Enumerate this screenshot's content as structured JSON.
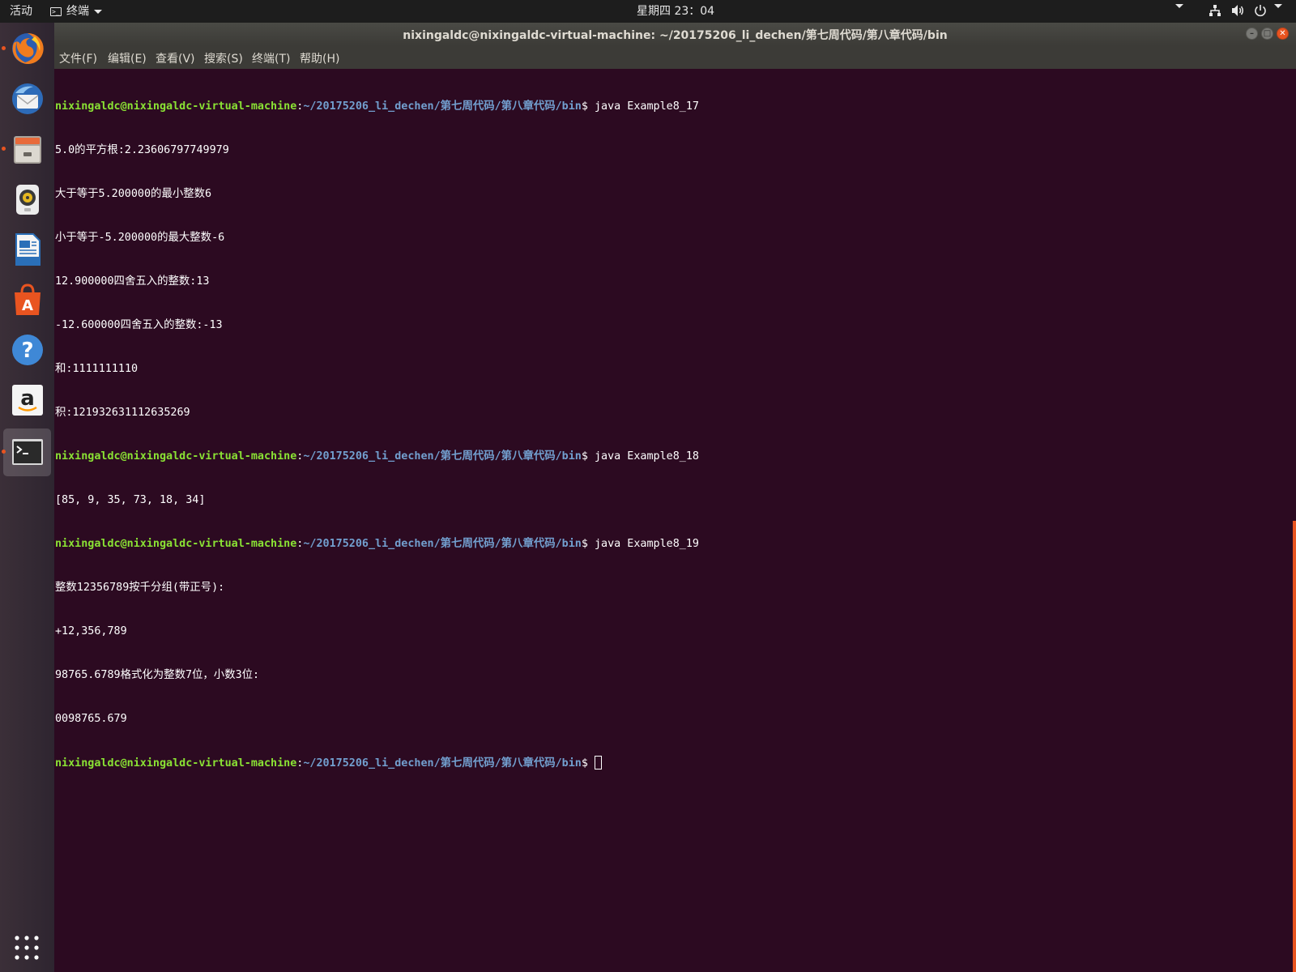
{
  "topbar": {
    "activities": "活动",
    "app_menu": "终端",
    "clock": "星期四 23：04",
    "icons": [
      "network-icon",
      "volume-icon",
      "power-icon"
    ]
  },
  "window": {
    "title": "nixingaldc@nixingaldc-virtual-machine: ~/20175206_li_dechen/第七周代码/第八章代码/bin"
  },
  "menubar": {
    "items": [
      "文件(F)",
      "编辑(E)",
      "查看(V)",
      "搜索(S)",
      "终端(T)",
      "帮助(H)"
    ]
  },
  "dock": {
    "items": [
      "firefox-icon",
      "thunderbird-icon",
      "files-icon",
      "rhythmbox-icon",
      "libreoffice-writer-icon",
      "software-center-icon",
      "help-icon",
      "amazon-icon",
      "terminal-icon"
    ],
    "show_apps": "show-applications-icon"
  },
  "terminal": {
    "prompt_user": "nixingaldc@nixingaldc-virtual-machine",
    "prompt_path": "~/20175206_li_dechen/第七周代码/第八章代码/bin",
    "prompt_sep": ":",
    "prompt_symbol": "$ ",
    "cmd1": "java Example8_17",
    "out1": [
      "5.0的平方根:2.23606797749979",
      "大于等于5.200000的最小整数6",
      "小于等于-5.200000的最大整数-6",
      "12.900000四舍五入的整数:13",
      "-12.600000四舍五入的整数:-13",
      "和:1111111110",
      "积:121932631112635269"
    ],
    "cmd2": "java Example8_18",
    "out2": [
      "[85, 9, 35, 73, 18, 34]"
    ],
    "cmd3": "java Example8_19",
    "out3": [
      "整数12356789按千分组(带正号):",
      "+12,356,789",
      "98765.6789格式化为整数7位，小数3位:",
      "0098765.679"
    ]
  },
  "colors": {
    "terminal_bg": "#2c0a21",
    "prompt_user": "#8ae234",
    "prompt_path": "#729fcf",
    "accent": "#e95420"
  }
}
